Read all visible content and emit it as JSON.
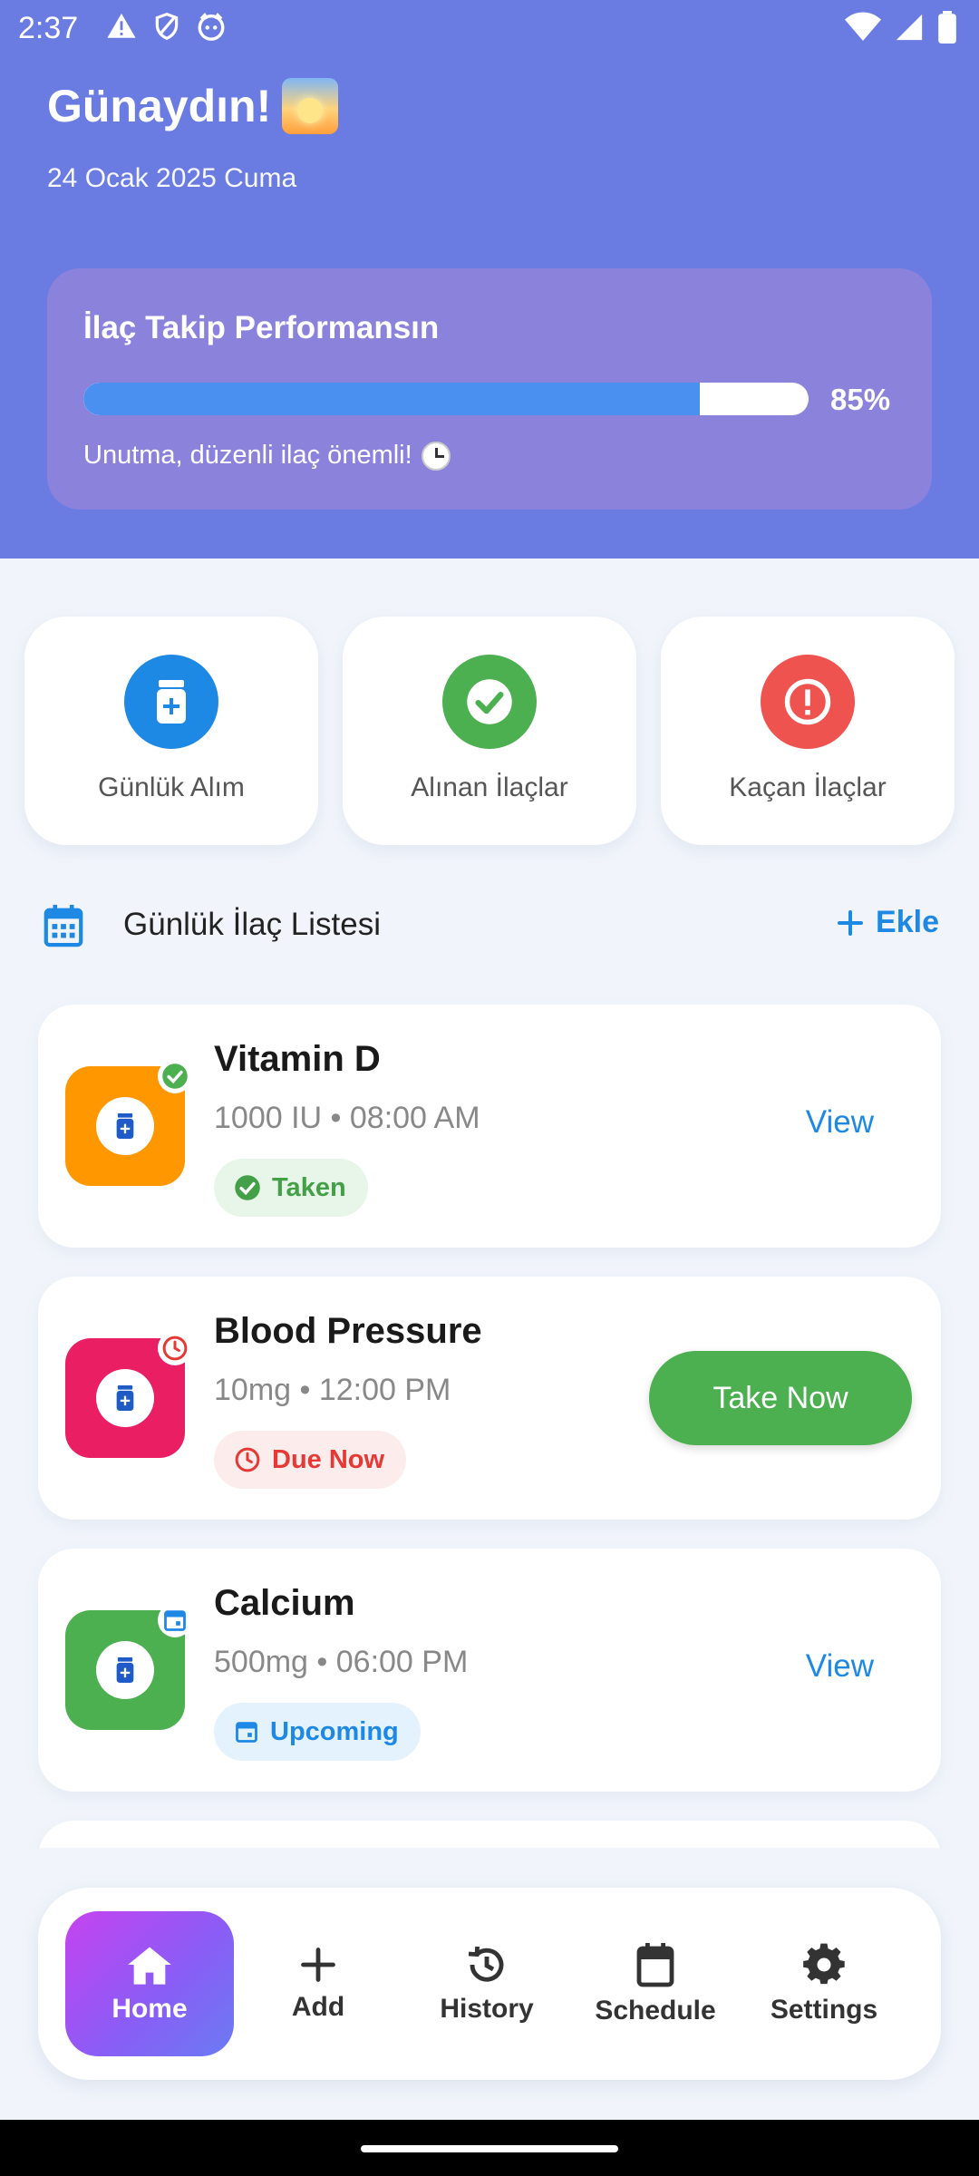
{
  "status_bar": {
    "time": "2:37"
  },
  "header": {
    "greeting": "Günaydın!",
    "date": "24 Ocak 2025 Cuma",
    "performance": {
      "title": "İlaç Takip Performansın",
      "progress": 0.85,
      "percent_label": "85%",
      "note": "Unutma, düzenli ilaç önemli!"
    }
  },
  "stats": [
    {
      "label": "Günlük Alım",
      "icon": "pill-bottle-icon",
      "color": "#1E88E5"
    },
    {
      "label": "Alınan İlaçlar",
      "icon": "check-circle-icon",
      "color": "#4CAF50"
    },
    {
      "label": "Kaçan İlaçlar",
      "icon": "alert-circle-icon",
      "color": "#EF5350"
    }
  ],
  "section": {
    "title": "Günlük İlaç Listesi",
    "add_label": "Ekle"
  },
  "medications": [
    {
      "name": "Vitamin D",
      "dose": "1000 IU • 08:00 AM",
      "status": "Taken",
      "action": "View",
      "thumb_color": "#FF9800",
      "badge_icon": "check-circle-icon"
    },
    {
      "name": "Blood Pressure",
      "dose": "10mg • 12:00 PM",
      "status": "Due Now",
      "action": "Take Now",
      "thumb_color": "#E91E63",
      "badge_icon": "clock-icon"
    },
    {
      "name": "Calcium",
      "dose": "500mg • 06:00 PM",
      "status": "Upcoming",
      "action": "View",
      "thumb_color": "#4CAF50",
      "badge_icon": "calendar-icon"
    }
  ],
  "bottom_nav": [
    {
      "label": "Home",
      "icon": "home-icon",
      "active": true
    },
    {
      "label": "Add",
      "icon": "plus-icon",
      "active": false
    },
    {
      "label": "History",
      "icon": "history-icon",
      "active": false
    },
    {
      "label": "Schedule",
      "icon": "calendar-icon",
      "active": false
    },
    {
      "label": "Settings",
      "icon": "gear-icon",
      "active": false
    }
  ]
}
